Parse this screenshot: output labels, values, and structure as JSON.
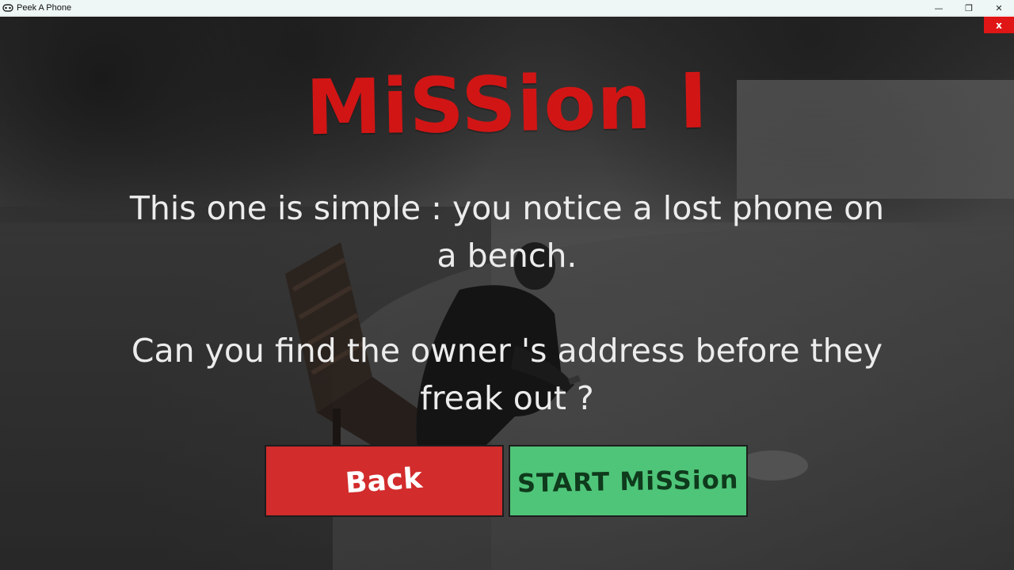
{
  "window": {
    "title": "Peek A Phone",
    "controls": {
      "minimize": "—",
      "restore": "❐",
      "close": "✕"
    }
  },
  "screen": {
    "close_label": "x",
    "title": "MiSSion I",
    "description_1": "This one is simple : you notice a lost phone on a bench.",
    "description_2": "Can you find the owner 's address before they freak out ?"
  },
  "buttons": {
    "back_label": "Back",
    "start_label": "START MiSSion"
  },
  "colors": {
    "title_red": "#d11515",
    "back_button": "#d22c2c",
    "start_button": "#4fc579",
    "close_button": "#e01616"
  },
  "icons": {
    "app": "game-controller-icon",
    "minimize": "minimize-icon",
    "restore": "restore-icon",
    "close": "close-icon"
  }
}
